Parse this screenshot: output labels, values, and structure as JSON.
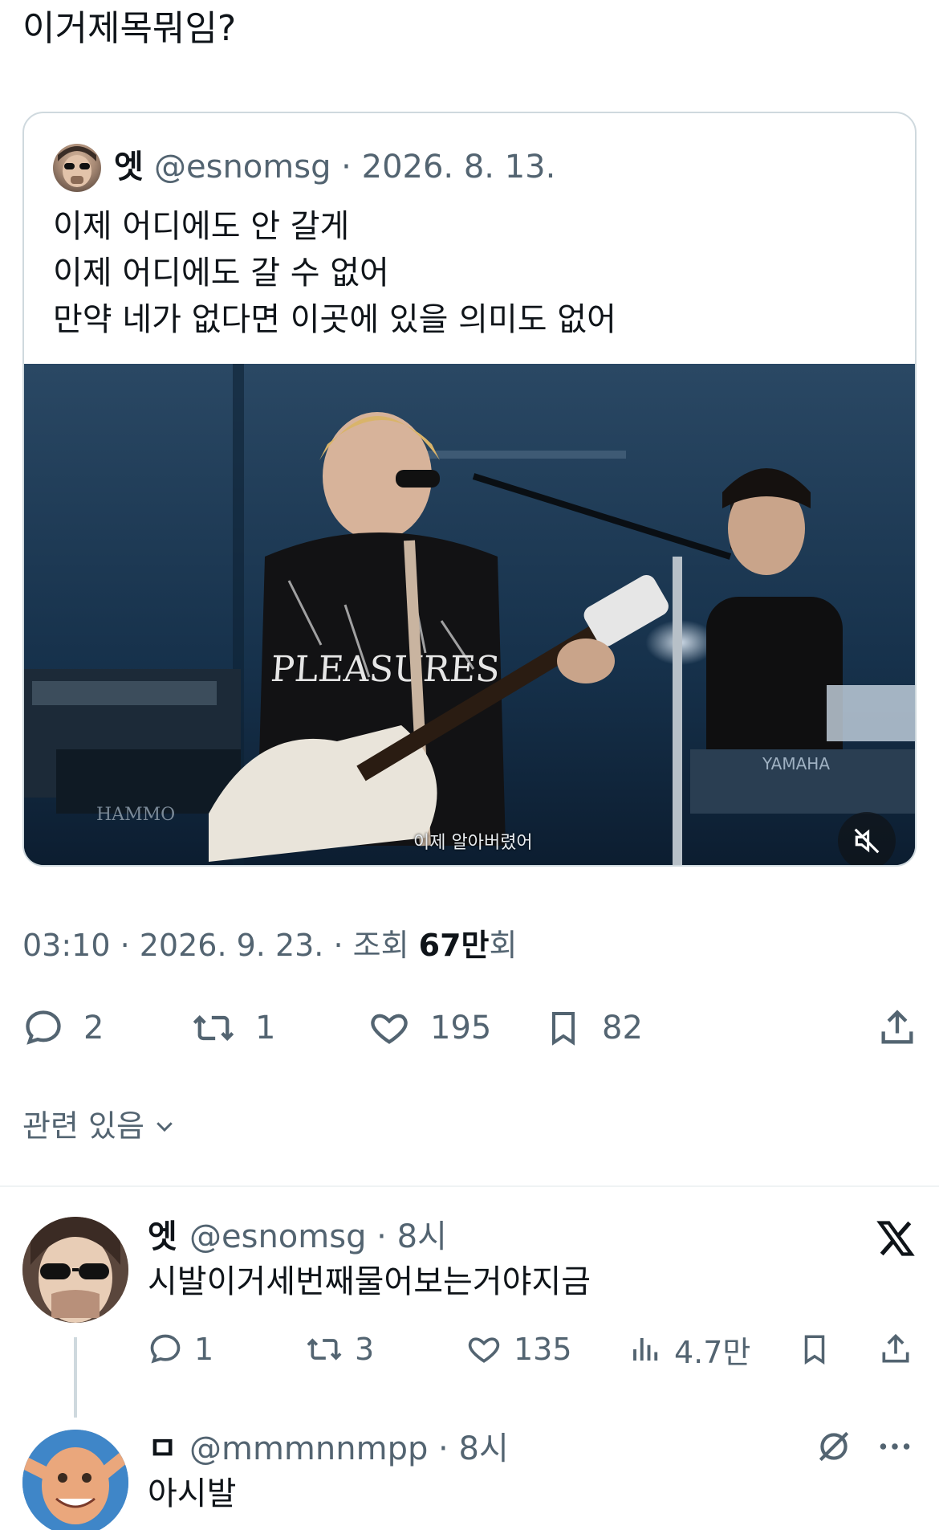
{
  "tweet": {
    "text": "이거제목뭐임?",
    "timestamp": "03:10 · 2026. 9. 23. · 조회 ",
    "views_count": "67만",
    "views_suffix": "회",
    "related": "관련 있음",
    "actions": {
      "replies": "2",
      "retweets": "1",
      "likes": "195",
      "bookmarks": "82"
    }
  },
  "quote": {
    "name": "엣",
    "handle": "@esnomsg · 2026. 8. 13.",
    "body": "이제 어디에도 안 갈게\n이제 어디에도 갈 수 없어\n만약 네가 없다면 이곳에 있을 의미도 없어",
    "media": {
      "subtitle": "이제 알아버렸어",
      "shirt_text": "PLEASURES",
      "brand_left": "HAMMO",
      "brand_right": "YAMAHA"
    }
  },
  "replies": [
    {
      "name": "엣",
      "handle": "@esnomsg · 8시",
      "text": "시발이거세번째물어보는거야지금",
      "actions": {
        "replies": "1",
        "retweets": "3",
        "likes": "135",
        "views": "4.7만"
      }
    },
    {
      "name": "ㅁ",
      "handle": "@mmmnnmpp · 8시",
      "text": "아시발"
    }
  ],
  "icons": [
    "reply-icon",
    "retweet-icon",
    "like-icon",
    "bookmark-icon",
    "share-icon",
    "views-icon",
    "x-logo-icon",
    "mute-icon",
    "chevron-down-icon",
    "more-icon",
    "grok-icon"
  ],
  "colors": {
    "text": "#0f1419",
    "muted": "#536471",
    "border": "#cfd9de"
  }
}
